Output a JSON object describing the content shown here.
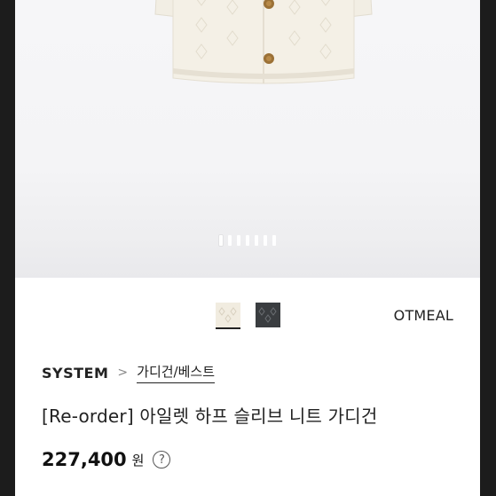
{
  "product": {
    "color_options": [
      {
        "icon": "cream-swatch-icon",
        "selected": true,
        "hex": "#f1ece0"
      },
      {
        "icon": "charcoal-swatch-icon",
        "selected": false,
        "hex": "#3a3d40"
      }
    ],
    "selected_color_name": "OTMEAL",
    "brand": "SYSTEM",
    "breadcrumb_separator": ">",
    "category": "가디건/베스트",
    "title": "[Re-order] 아일렛 하프 슬리브 니트 가디건",
    "price": "227,400",
    "currency": "원",
    "help_icon_glyph": "?"
  },
  "gallery": {
    "image_count": 7,
    "active_index": 0
  }
}
